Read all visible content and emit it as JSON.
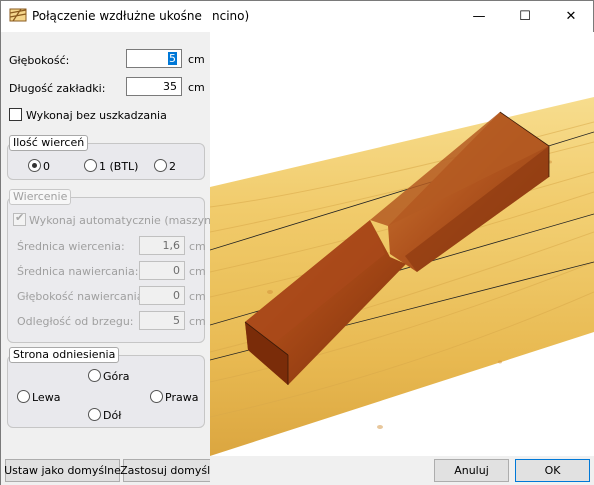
{
  "window": {
    "title": "Połączenie wzdłużne ukośne",
    "title_tail": "ncino)",
    "minimize": "—",
    "maximize": "☐",
    "close": "✕"
  },
  "form": {
    "depth_label": "Głębokość:",
    "depth_value": "5",
    "depth_unit": "cm",
    "lap_length_label": "Długość zakładki:",
    "lap_length_value": "35",
    "lap_length_unit": "cm",
    "no_damage_label": "Wykonaj bez uszkadzania"
  },
  "drill_count": {
    "title": "Ilość wierceń",
    "options": [
      "0",
      "1 (BTL)",
      "2"
    ],
    "selected": "0"
  },
  "drilling": {
    "title": "Wiercenie",
    "auto_label": "Wykonaj automatycznie (maszyna)",
    "auto_checked": true,
    "rows": [
      {
        "label": "Średnica wiercenia:",
        "value": "1,6",
        "unit": "cm"
      },
      {
        "label": "Średnica nawiercania:",
        "value": "0",
        "unit": "cm"
      },
      {
        "label": "Głębokość nawiercania:",
        "value": "0",
        "unit": "cm"
      },
      {
        "label": "Odległość od brzegu:",
        "value": "5",
        "unit": "cm"
      }
    ]
  },
  "reference_side": {
    "title": "Strona odniesienia",
    "top": "Góra",
    "left": "Lewa",
    "right": "Prawa",
    "bottom": "Dół"
  },
  "buttons": {
    "set_default": "Ustaw jako domyślne",
    "apply_default": "Zastosuj domyślne",
    "cancel": "Anuluj",
    "ok": "OK"
  },
  "colors": {
    "wood_light": "#f3d27a",
    "wood_dark": "#b5561b",
    "accent": "#0078d7"
  }
}
